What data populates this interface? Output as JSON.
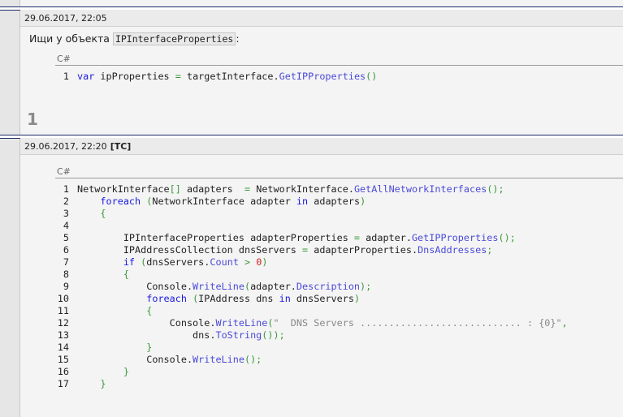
{
  "posts": [
    {
      "timestamp": "29.06.2017, 22:05",
      "text_before": "Ищи у объекта ",
      "inline_code": "IPInterfaceProperties",
      "text_after": ":",
      "code_lang": "C#",
      "code": [
        [
          [
            "k",
            "var"
          ],
          [
            "p",
            " ipProperties "
          ],
          [
            "g",
            "="
          ],
          [
            "p",
            " targetInterface."
          ],
          [
            "m",
            "GetIPProperties"
          ],
          [
            "g",
            "()"
          ]
        ]
      ],
      "score": "1"
    },
    {
      "timestamp": "29.06.2017, 22:20",
      "tag": "[TC]",
      "code_lang": "C#",
      "code": [
        [
          [
            "p",
            "NetworkInterface"
          ],
          [
            "g",
            "[]"
          ],
          [
            "p",
            " adapters  "
          ],
          [
            "g",
            "="
          ],
          [
            "p",
            " NetworkInterface."
          ],
          [
            "m",
            "GetAllNetworkInterfaces"
          ],
          [
            "g",
            "();"
          ]
        ],
        [
          [
            "p",
            "    "
          ],
          [
            "k",
            "foreach"
          ],
          [
            "p",
            " "
          ],
          [
            "g",
            "("
          ],
          [
            "p",
            "NetworkInterface adapter "
          ],
          [
            "k",
            "in"
          ],
          [
            "p",
            " adapters"
          ],
          [
            "g",
            ")"
          ]
        ],
        [
          [
            "p",
            "    "
          ],
          [
            "g",
            "{"
          ]
        ],
        [
          [
            "p",
            ""
          ]
        ],
        [
          [
            "p",
            "        IPInterfaceProperties adapterProperties "
          ],
          [
            "g",
            "="
          ],
          [
            "p",
            " adapter."
          ],
          [
            "m",
            "GetIPProperties"
          ],
          [
            "g",
            "();"
          ]
        ],
        [
          [
            "p",
            "        IPAddressCollection dnsServers "
          ],
          [
            "g",
            "="
          ],
          [
            "p",
            " adapterProperties."
          ],
          [
            "m",
            "DnsAddresses"
          ],
          [
            "g",
            ";"
          ]
        ],
        [
          [
            "p",
            "        "
          ],
          [
            "k",
            "if"
          ],
          [
            "p",
            " "
          ],
          [
            "g",
            "("
          ],
          [
            "p",
            "dnsServers."
          ],
          [
            "m",
            "Count"
          ],
          [
            "p",
            " "
          ],
          [
            "g",
            ">"
          ],
          [
            "p",
            " "
          ],
          [
            "n",
            "0"
          ],
          [
            "g",
            ")"
          ]
        ],
        [
          [
            "p",
            "        "
          ],
          [
            "g",
            "{"
          ]
        ],
        [
          [
            "p",
            "            Console."
          ],
          [
            "m",
            "WriteLine"
          ],
          [
            "g",
            "("
          ],
          [
            "p",
            "adapter."
          ],
          [
            "m",
            "Description"
          ],
          [
            "g",
            ");"
          ]
        ],
        [
          [
            "p",
            "            "
          ],
          [
            "k",
            "foreach"
          ],
          [
            "p",
            " "
          ],
          [
            "g",
            "("
          ],
          [
            "p",
            "IPAddress dns "
          ],
          [
            "k",
            "in"
          ],
          [
            "p",
            " dnsServers"
          ],
          [
            "g",
            ")"
          ]
        ],
        [
          [
            "p",
            "            "
          ],
          [
            "g",
            "{"
          ]
        ],
        [
          [
            "p",
            "                Console."
          ],
          [
            "m",
            "WriteLine"
          ],
          [
            "g",
            "("
          ],
          [
            "s",
            "\"  DNS Servers ............................ : {0}\""
          ],
          [
            "g",
            ","
          ]
        ],
        [
          [
            "p",
            "                    dns."
          ],
          [
            "m",
            "ToString"
          ],
          [
            "g",
            "());"
          ]
        ],
        [
          [
            "p",
            "            "
          ],
          [
            "g",
            "}"
          ]
        ],
        [
          [
            "p",
            "            Console."
          ],
          [
            "m",
            "WriteLine"
          ],
          [
            "g",
            "();"
          ]
        ],
        [
          [
            "p",
            "        "
          ],
          [
            "g",
            "}"
          ]
        ],
        [
          [
            "p",
            "    "
          ],
          [
            "g",
            "}"
          ]
        ]
      ]
    }
  ]
}
